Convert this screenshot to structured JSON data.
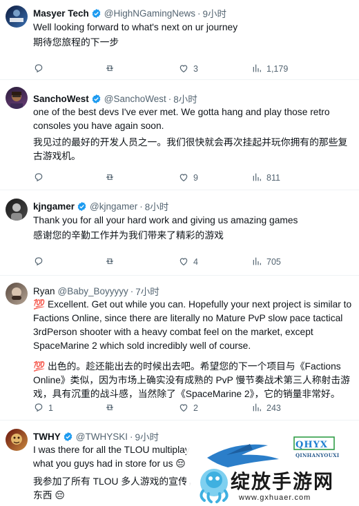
{
  "tweets": [
    {
      "name": "Masyer Tech",
      "handle": "@HighNGamingNews",
      "time": "9小时",
      "text": "Well looking forward to what's next on ur journey",
      "translation": "期待您旅程的下一步",
      "likes": "3",
      "views": "1,179",
      "verified": true,
      "avatar_colors": [
        "#1b1b2f",
        "#3a6fb0"
      ]
    },
    {
      "name": "SanchoWest",
      "handle": "@SanchoWest",
      "time": "8小时",
      "text": "one of the best devs I've ever met. We gotta hang and play those retro consoles you have again soon.",
      "translation": "我见过的最好的开发人员之一。我们很快就会再次挂起并玩你拥有的那些复古游戏机。",
      "likes": "9",
      "views": "811",
      "verified": true,
      "avatar_colors": [
        "#2a1d3a",
        "#8b5a3c"
      ]
    },
    {
      "name": "kjngamer",
      "handle": "@kjngamer",
      "time": "8小时",
      "text": "Thank you for all your hard work and giving us amazing games",
      "translation": "感谢您的辛勤工作并为我们带来了精彩的游戏",
      "likes": "4",
      "views": "705",
      "verified": true,
      "avatar_colors": [
        "#222222",
        "#6d6d6d"
      ]
    },
    {
      "name": "Ryan",
      "handle": "@Baby_Boyyyyy",
      "time": "7小时",
      "text": "💯 Excellent. Get out while you can. Hopefully your next project is similar to Factions Online, since there are literally no Mature PvP slow pace tactical 3rdPerson shooter with a heavy combat feel on the market, except SpaceMarine 2 which sold incredibly well of course.",
      "translation": "💯 出色的。趁还能出去的时候出去吧。希望您的下一个项目与《Factions Online》类似，因为市场上确实没有成熟的 PvP 慢节奏战术第三人称射击游戏，具有沉重的战斗感，当然除了《SpaceMarine 2》，它的销量非常好。",
      "replies": "1",
      "likes": "2",
      "views": "243",
      "verified": false,
      "avatar_colors": [
        "#6a5a4e",
        "#c9b8a8"
      ]
    },
    {
      "name": "TWHY",
      "handle": "@TWHYSKI",
      "time": "9小时",
      "text": "I was there for all the TLOU multiplay\nwhat you guys had in store for us 😔",
      "translation": "我参加了所有 TLOU 多人游戏的宣传，\n东西 😔",
      "verified": true,
      "avatar_colors": [
        "#7a1d12",
        "#e0b46a"
      ]
    }
  ],
  "watermark": {
    "brand": "QHYX",
    "brand_sub": "QINHANYOUXI",
    "name_cn": "绽放手游网",
    "url": "www.gxhuaer.com"
  },
  "icons": [
    "reply-icon",
    "retweet-icon",
    "like-icon",
    "views-icon",
    "verified-icon"
  ],
  "colors": {
    "verified": "#1d9bf0",
    "secondary_text": "#536471"
  }
}
